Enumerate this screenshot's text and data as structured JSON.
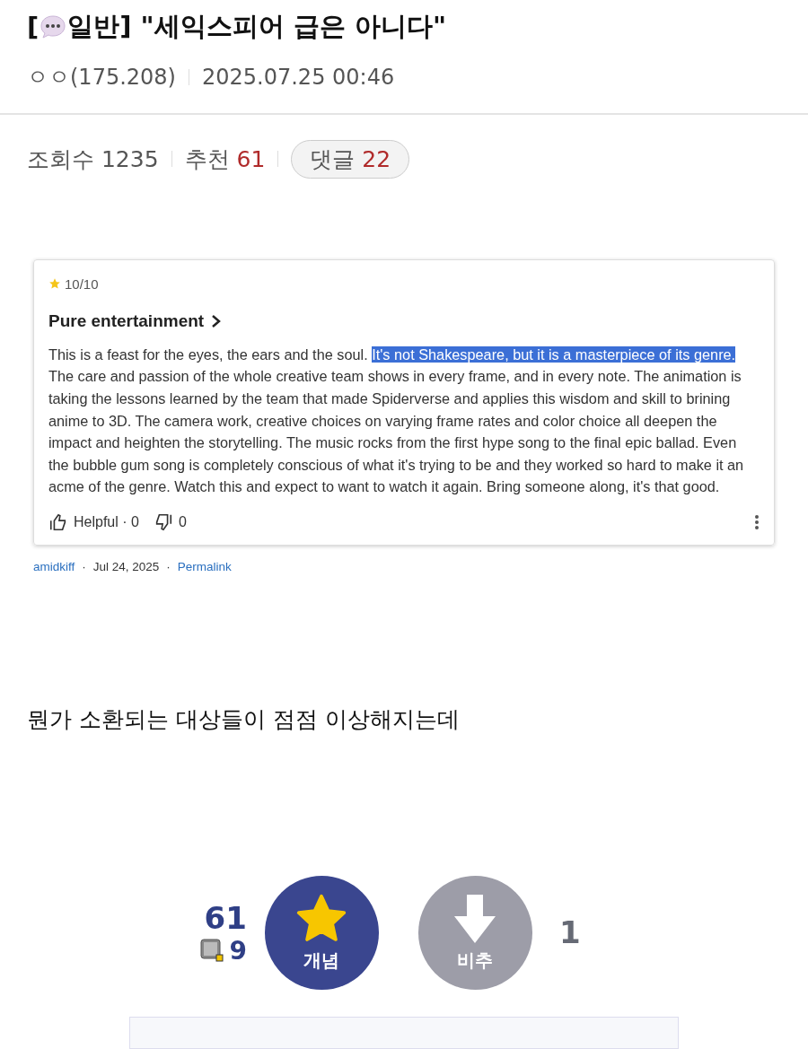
{
  "post": {
    "bracket": "[",
    "title": "일반] \"세익스피어 급은 아니다\"",
    "author": "ㅇㅇ(175.208)",
    "date": "2025.07.25 00:46"
  },
  "stats": [
    {
      "kind": "plain",
      "label": "조회수",
      "value": "1235"
    },
    {
      "kind": "plain",
      "label": "추천",
      "value": "61"
    },
    {
      "kind": "pill",
      "label": "댓글",
      "value": "22"
    }
  ],
  "review": {
    "rating": "10/10",
    "title": "Pure entertainment",
    "body": [
      {
        "text": "This is a feast for the eyes, the ears and the soul. ",
        "highlighted": false
      },
      {
        "text": "It's not Shakespeare, but it is a masterpiece of its genre.",
        "highlighted": true
      },
      {
        "text": " The care and passion of the whole creative team shows in every frame, and in every note. The animation is taking the lessons learned by the team that made Spiderverse and applies this wisdom and skill to brining anime to 3D. The camera work, creative choices on varying frame rates and color choice all deepen the impact and heighten the storytelling. The music rocks from the first hype song to the final epic ballad. Even the bubble gum song is completely conscious of what it's trying to be and they worked so hard to make it an acme of the genre. Watch this and expect to want to watch it again. Bring someone along, it's that good.",
        "highlighted": false
      }
    ],
    "helpful_label": "Helpful · 0",
    "separator": "·",
    "unhelpful_count": "0",
    "author": "amidkiff",
    "date": "Jul 24, 2025",
    "permalink": "Permalink"
  },
  "comment": "뭔가 소환되는 대상들이 점점 이상해지는데",
  "votes": {
    "up_count": "61",
    "fixed_count": "9",
    "up_label": "개념",
    "down_label": "비추",
    "down_count": "1"
  }
}
